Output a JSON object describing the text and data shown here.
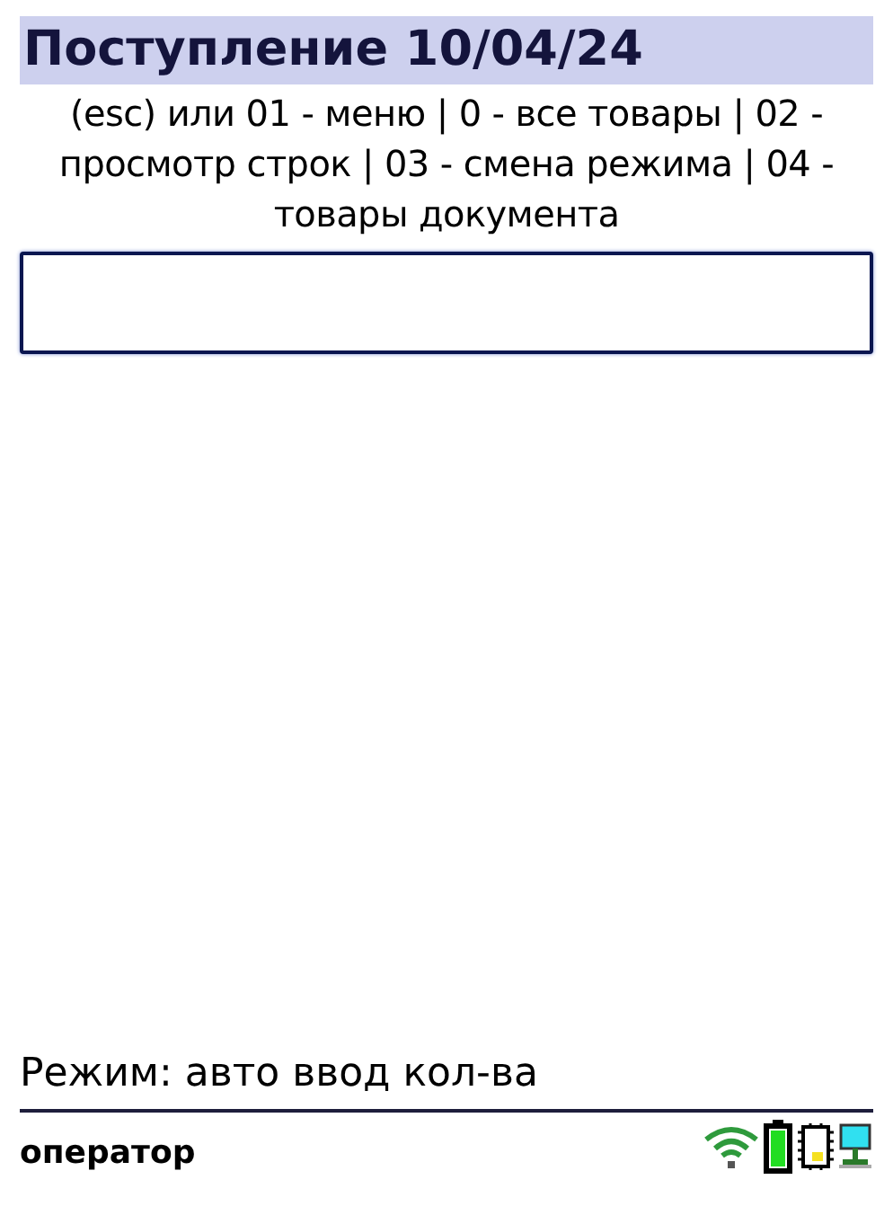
{
  "title": "Поступление 10/04/24",
  "hint": "(esc) или 01 - меню | 0 - все товары | 02 - просмотр строк | 03 - смена режима | 04 - товары документа",
  "mode": "Режим: авто ввод кол-ва",
  "status_bar": {
    "user": "оператор"
  }
}
